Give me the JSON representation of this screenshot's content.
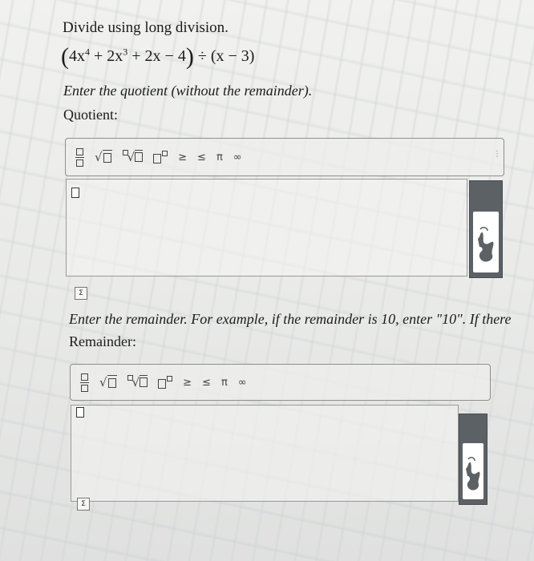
{
  "question": {
    "instruction": "Divide using long division.",
    "expression": {
      "open": "(",
      "t1": "4x",
      "t1_exp": "4",
      "t2": " + 2x",
      "t2_exp": "3",
      "t3": " + 2x − 4",
      "close": ")",
      "divisor": " ÷ (x − 3)"
    }
  },
  "quotient": {
    "prompt": "Enter the quotient (without the remainder).",
    "label": "Quotient:"
  },
  "remainder": {
    "prompt": "Enter the remainder. For example, if the remainder is 10, enter \"10\". If there",
    "label": "Remainder:"
  },
  "toolbar": {
    "geq": "≥",
    "leq": "≤",
    "pi": "π",
    "inf": "∞",
    "dots": "⋮"
  },
  "sigma_label": "Σ"
}
